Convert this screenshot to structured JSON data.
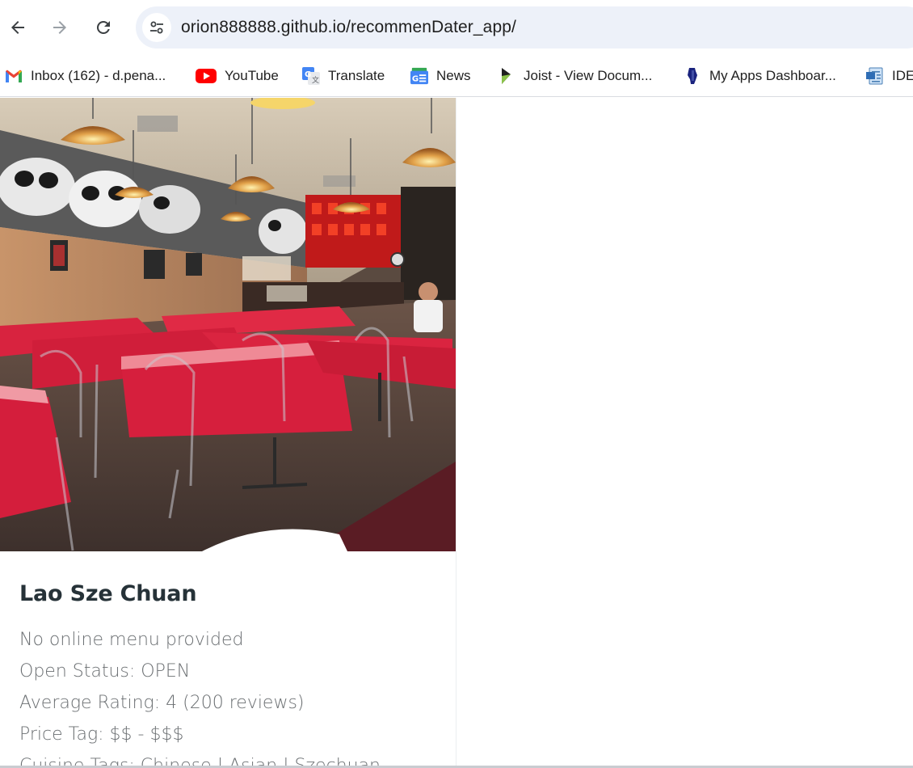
{
  "browser": {
    "url": "orion888888.github.io/recommenDater_app/",
    "bookmarks": [
      {
        "label": "Inbox (162) - d.pena...",
        "icon": "gmail-icon"
      },
      {
        "label": "YouTube",
        "icon": "youtube-icon"
      },
      {
        "label": "Translate",
        "icon": "translate-icon"
      },
      {
        "label": "News",
        "icon": "news-icon"
      },
      {
        "label": "Joist - View Docum...",
        "icon": "joist-icon"
      },
      {
        "label": "My Apps Dashboar...",
        "icon": "illinois-icon"
      },
      {
        "label": "IDE",
        "icon": "document-icon"
      }
    ]
  },
  "restaurant": {
    "name": "Lao Sze Chuan",
    "menu": "No online menu provided",
    "open_status": "Open Status: OPEN",
    "rating": "Average Rating: 4 (200 reviews)",
    "price": "Price Tag: $$ - $$$",
    "cuisine": "Cuisine Tags: Chinese | Asian | Szechuan"
  },
  "colors": {
    "omnibox": "#edf1f9",
    "tablecloth": "#d8233f",
    "title_text": "#263238",
    "body_text": "#6b6f72"
  }
}
